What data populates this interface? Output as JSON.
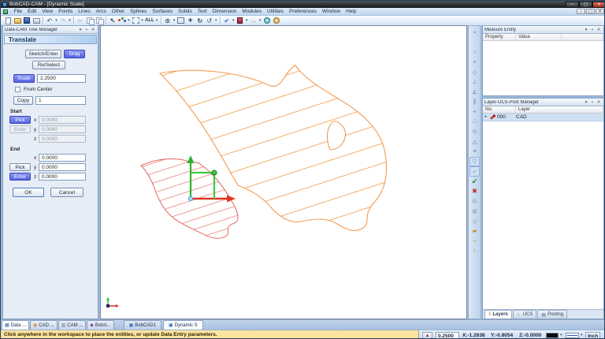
{
  "window": {
    "title": "BobCAD-CAM - [Dynamic Scale]"
  },
  "menu": [
    "File",
    "Edit",
    "View",
    "Points",
    "Lines",
    "Arcs",
    "Other",
    "Splines",
    "Surfaces",
    "Solids",
    "Text",
    "Dimension",
    "Modules",
    "Utilities",
    "Preferences",
    "Window",
    "Help"
  ],
  "toolbar": {
    "all_label": "ALL"
  },
  "tree_panel": {
    "title": "Data-CAM Tree Manager",
    "translate": {
      "header": "Translate",
      "sketch_enter_btn": "Sketch/Enter",
      "drag_btn": "Drag",
      "reselect_btn": "Re/Select",
      "scale_btn": "Scale",
      "scale_value": "2.2500",
      "from_center_label": "From Center",
      "copy_btn": "Copy",
      "copy_value": "1",
      "start_label": "Start",
      "end_label": "End",
      "pick_btn": "Pick",
      "enter_btn": "Enter",
      "axis_x": "x",
      "axis_y": "y",
      "axis_z": "z",
      "start_x": "0.0000",
      "start_y": "0.0000",
      "start_z": "0.0000",
      "end_x": "0.0000",
      "end_y": "0.0000",
      "end_z": "0.0000",
      "ok_btn": "OK",
      "cancel_btn": "Cancel"
    }
  },
  "measure_panel": {
    "title": "Measure Entity",
    "col_property": "Property",
    "col_value": "Value"
  },
  "layer_panel": {
    "title": "Layer-UCS-Post Manager",
    "col_no": "No.",
    "col_layer": "Layer",
    "row": {
      "bullet": "•",
      "no": "000",
      "layer": "CAD"
    },
    "tab_layers": "Layers",
    "tab_ucs": "UCS",
    "tab_posting": "Posting"
  },
  "bottom_tabs": {
    "data_tab": "Data ...",
    "cad_tab": "CAD ...",
    "cam_tab": "CAM ...",
    "bobart_tab": "BobA...",
    "doc1": "BobCAD1",
    "doc2": "Dynamic S"
  },
  "statusbar": {
    "message": "Click anywhere in the workspace to place the entities, or update Data Entry parameters.",
    "snap_value": "0.2500",
    "coord_x": "X:-1.2638",
    "coord_y": "Y:-0.8054",
    "coord_z": "Z:-0.0000",
    "units": "Inch"
  },
  "colors": {
    "orange_outline": "#f39a4f",
    "orange_hatch": "#f6ad68",
    "red_outline": "#e4645f",
    "red_hatch": "#ef918c",
    "axis_green": "#2db32d",
    "axis_red": "#e03524",
    "handle_green": "#3ecc3e",
    "origin_dot": "#a9d9f2"
  },
  "icons": {
    "dropdown": "▾",
    "caption_menu": "▾",
    "caption_pin": "▪",
    "caption_close": "✕",
    "win_min": "–",
    "win_max": "▢",
    "win_close": "✕",
    "undo": "↶",
    "redo": "↷",
    "cut": "✂",
    "select": "↖",
    "zoom": "⊙",
    "pan": "+",
    "rotate": "↻",
    "orbit": "↺",
    "check": "✔",
    "post_arrow": "→",
    "snap_pointer": "▲",
    "layers_tab": "≡",
    "ucs_tab": "∟",
    "posting_tab": "▤",
    "data_tab": "▦",
    "cad_tab": "◉",
    "cam_tab": "▥",
    "bobart_tab": "◆",
    "doc_tab": "▣",
    "right_toolbar": [
      "▪",
      "∙",
      "○",
      "×",
      "◇",
      "⊥",
      "∠",
      "∥",
      "+",
      "□",
      "⊙",
      "△",
      "≡",
      "▽",
      "✔",
      "✔",
      "✖",
      "▤",
      "▦",
      "◎",
      "▰",
      "↔",
      "↕"
    ]
  }
}
